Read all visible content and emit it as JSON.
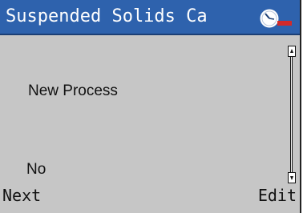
{
  "header": {
    "title": "Suspended Solids Ca",
    "status_icon": "clock-gauge-icon",
    "accent_color": "#2e62ad",
    "status_color": "#d22a2a"
  },
  "menu": {
    "items": [
      {
        "label": "New Process"
      },
      {
        "label": "No"
      }
    ]
  },
  "softkeys": {
    "left_label": "Next",
    "right_label": "Edit"
  }
}
